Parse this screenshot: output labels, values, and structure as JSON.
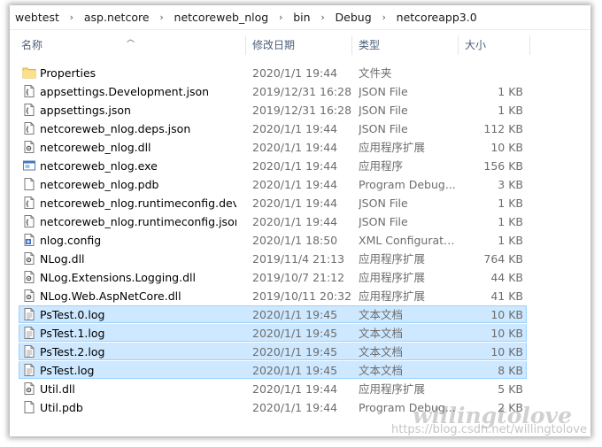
{
  "breadcrumb": [
    "webtest",
    "asp.netcore",
    "netcoreweb_nlog",
    "bin",
    "Debug",
    "netcoreapp3.0"
  ],
  "columns": {
    "name": "名称",
    "date": "修改日期",
    "type": "类型",
    "size": "大小"
  },
  "files": [
    {
      "name": "Properties",
      "date": "2020/1/1 19:44",
      "type": "文件夹",
      "size": "",
      "icon": "folder-icon"
    },
    {
      "name": "appsettings.Development.json",
      "date": "2019/12/31 16:28",
      "type": "JSON File",
      "size": "1 KB",
      "icon": "json-file-icon"
    },
    {
      "name": "appsettings.json",
      "date": "2019/12/31 16:28",
      "type": "JSON File",
      "size": "1 KB",
      "icon": "json-file-icon"
    },
    {
      "name": "netcoreweb_nlog.deps.json",
      "date": "2020/1/1 19:44",
      "type": "JSON File",
      "size": "112 KB",
      "icon": "json-file-icon"
    },
    {
      "name": "netcoreweb_nlog.dll",
      "date": "2020/1/1 19:44",
      "type": "应用程序扩展",
      "size": "10 KB",
      "icon": "dll-file-icon"
    },
    {
      "name": "netcoreweb_nlog.exe",
      "date": "2020/1/1 19:44",
      "type": "应用程序",
      "size": "156 KB",
      "icon": "exe-file-icon"
    },
    {
      "name": "netcoreweb_nlog.pdb",
      "date": "2020/1/1 19:44",
      "type": "Program Debug...",
      "size": "3 KB",
      "icon": "blank-file-icon"
    },
    {
      "name": "netcoreweb_nlog.runtimeconfig.dev.j...",
      "date": "2020/1/1 19:44",
      "type": "JSON File",
      "size": "1 KB",
      "icon": "json-file-icon"
    },
    {
      "name": "netcoreweb_nlog.runtimeconfig.json",
      "date": "2020/1/1 19:44",
      "type": "JSON File",
      "size": "1 KB",
      "icon": "json-file-icon"
    },
    {
      "name": "nlog.config",
      "date": "2020/1/1 18:50",
      "type": "XML Configurati...",
      "size": "1 KB",
      "icon": "config-file-icon"
    },
    {
      "name": "NLog.dll",
      "date": "2019/11/4 21:13",
      "type": "应用程序扩展",
      "size": "764 KB",
      "icon": "dll-file-icon"
    },
    {
      "name": "NLog.Extensions.Logging.dll",
      "date": "2019/10/7 21:12",
      "type": "应用程序扩展",
      "size": "44 KB",
      "icon": "dll-file-icon"
    },
    {
      "name": "NLog.Web.AspNetCore.dll",
      "date": "2019/10/11 20:32",
      "type": "应用程序扩展",
      "size": "41 KB",
      "icon": "dll-file-icon"
    },
    {
      "name": "PsTest.0.log",
      "date": "2020/1/1 19:45",
      "type": "文本文档",
      "size": "10 KB",
      "icon": "text-file-icon",
      "selected": true
    },
    {
      "name": "PsTest.1.log",
      "date": "2020/1/1 19:45",
      "type": "文本文档",
      "size": "10 KB",
      "icon": "text-file-icon",
      "selected": true
    },
    {
      "name": "PsTest.2.log",
      "date": "2020/1/1 19:45",
      "type": "文本文档",
      "size": "10 KB",
      "icon": "text-file-icon",
      "selected": true
    },
    {
      "name": "PsTest.log",
      "date": "2020/1/1 19:45",
      "type": "文本文档",
      "size": "8 KB",
      "icon": "text-file-icon",
      "selected": true
    },
    {
      "name": "Util.dll",
      "date": "2020/1/1 19:44",
      "type": "应用程序扩展",
      "size": "5 KB",
      "icon": "dll-file-icon"
    },
    {
      "name": "Util.pdb",
      "date": "2020/1/1 19:44",
      "type": "Program Debug...",
      "size": "2 KB",
      "icon": "blank-file-icon"
    }
  ],
  "watermark": {
    "script": "willingtolove",
    "url": "https://blog.csdn.net/willingtolove"
  }
}
